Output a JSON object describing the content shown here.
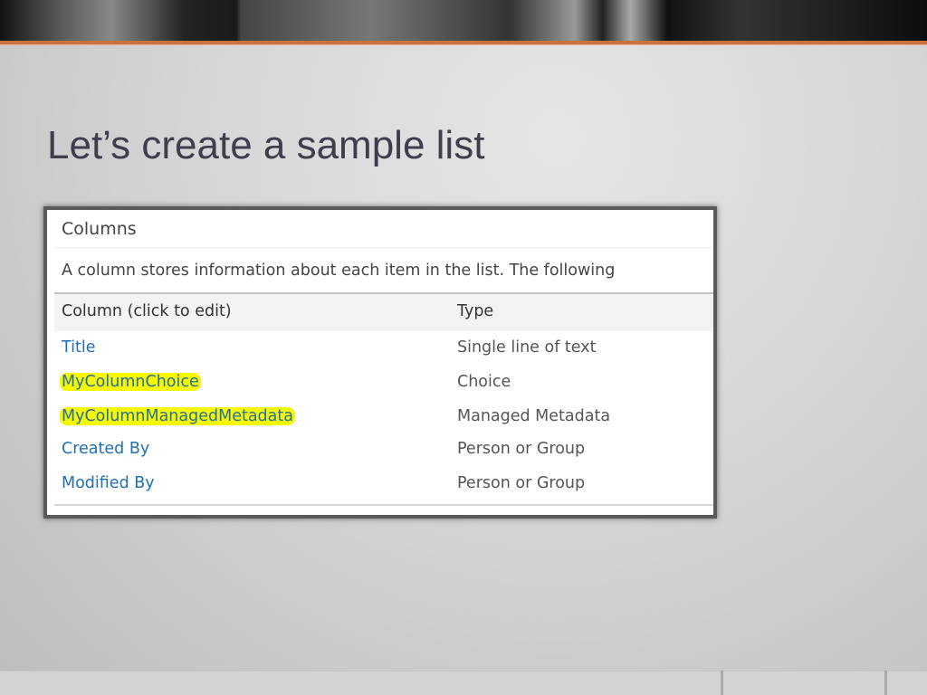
{
  "slide": {
    "title": "Let’s create a sample list"
  },
  "screenshot": {
    "section_title": "Columns",
    "description": "A column stores information about each item in the list. The following",
    "headers": {
      "column": "Column (click to edit)",
      "type": "Type"
    },
    "rows": [
      {
        "name": "Title",
        "type": "Single line of text",
        "highlighted": false
      },
      {
        "name": "MyColumnChoice",
        "type": "Choice",
        "highlighted": true
      },
      {
        "name": "MyColumnManagedMetadata",
        "type": "Managed Metadata",
        "highlighted": true
      },
      {
        "name": "Created By",
        "type": "Person or Group",
        "highlighted": false
      },
      {
        "name": "Modified By",
        "type": "Person or Group",
        "highlighted": false
      }
    ],
    "colors": {
      "link": "#1f6fb5",
      "highlight": "#f4f800",
      "accent": "#c8733f"
    }
  }
}
